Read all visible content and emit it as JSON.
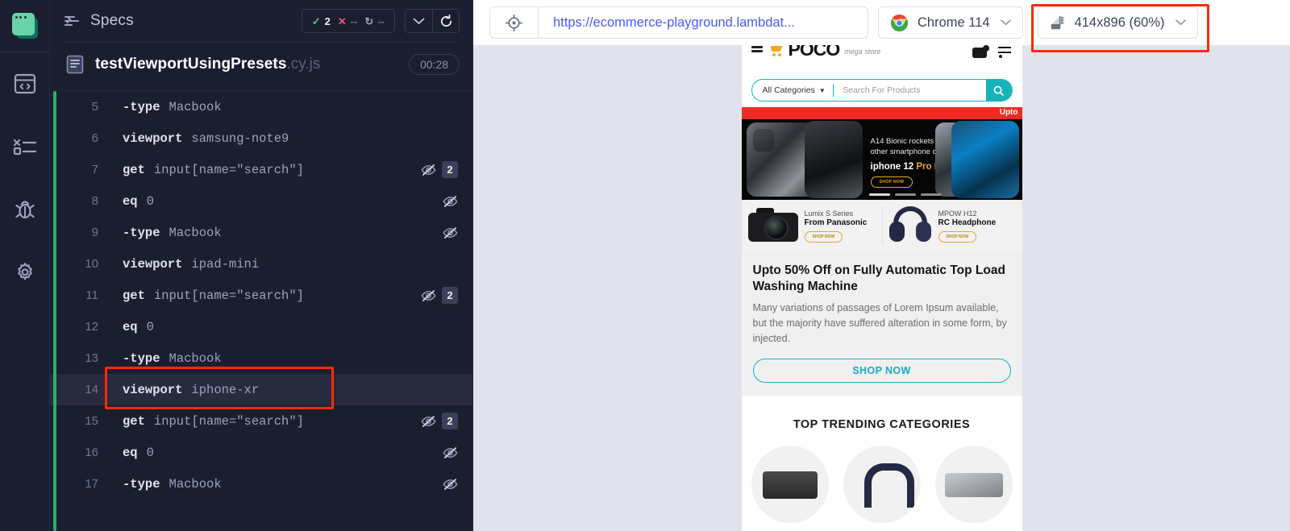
{
  "sidebar": {
    "items": [
      {
        "name": "cypress-logo",
        "label": "Cypress"
      },
      {
        "name": "specs",
        "label": "Specs"
      },
      {
        "name": "runs",
        "label": "Runs"
      },
      {
        "name": "debug",
        "label": "Debug"
      },
      {
        "name": "settings",
        "label": "Settings"
      }
    ]
  },
  "log_header": {
    "title": "Specs",
    "stats": {
      "passed_mark": "✓",
      "passed": "2",
      "failed_mark": "✕",
      "failed": "--",
      "pending_mark": "↻",
      "pending": "--"
    },
    "collapse_label": "Collapse",
    "reload_label": "Reload"
  },
  "spec": {
    "name": "testViewportUsingPresets",
    "extension": ".cy.js",
    "duration": "00:28"
  },
  "commands": [
    {
      "num": "5",
      "method": "-type",
      "arg": "Macbook",
      "hidden": false,
      "count": ""
    },
    {
      "num": "6",
      "method": "viewport",
      "arg": "samsung-note9",
      "hidden": false,
      "count": ""
    },
    {
      "num": "7",
      "method": "get",
      "arg": "input[name=\"search\"]",
      "hidden": true,
      "count": "2"
    },
    {
      "num": "8",
      "method": "eq",
      "arg": "0",
      "hidden": true,
      "count": ""
    },
    {
      "num": "9",
      "method": "-type",
      "arg": "Macbook",
      "hidden": true,
      "count": ""
    },
    {
      "num": "10",
      "method": "viewport",
      "arg": "ipad-mini",
      "hidden": false,
      "count": ""
    },
    {
      "num": "11",
      "method": "get",
      "arg": "input[name=\"search\"]",
      "hidden": true,
      "count": "2"
    },
    {
      "num": "12",
      "method": "eq",
      "arg": "0",
      "hidden": false,
      "count": ""
    },
    {
      "num": "13",
      "method": "-type",
      "arg": "Macbook",
      "hidden": false,
      "count": ""
    },
    {
      "num": "14",
      "method": "viewport",
      "arg": "iphone-xr",
      "hidden": false,
      "count": "",
      "selected": true,
      "highlighted": true
    },
    {
      "num": "15",
      "method": "get",
      "arg": "input[name=\"search\"]",
      "hidden": true,
      "count": "2"
    },
    {
      "num": "16",
      "method": "eq",
      "arg": "0",
      "hidden": true,
      "count": ""
    },
    {
      "num": "17",
      "method": "-type",
      "arg": "Macbook",
      "hidden": true,
      "count": ""
    }
  ],
  "topbar": {
    "selector_playground_label": "Open Selector Playground",
    "url": "https://ecommerce-playground.lambdat...",
    "browser": "Chrome 114",
    "viewport": "414x896 (60%)",
    "chevron": "⌄",
    "viewport_highlighted": true
  },
  "app": {
    "logo_text": "POCO",
    "logo_sub": "mega store",
    "category_select": "All Categories",
    "search_placeholder": "Search For Products",
    "red_strip_text": "Upto",
    "hero": {
      "line1": "A14 Bionic rockets past",
      "line2": "other smartphone chip.",
      "brand": "iphone 12 ",
      "brand_accent": "Pro Max",
      "cta": "SHOP NOW"
    },
    "promos": [
      {
        "top": "Lumix S Series",
        "bottom": "From Panasonic",
        "cta": "SHOP NOW"
      },
      {
        "top": "MPOW H12",
        "bottom": "RC Headphone",
        "cta": "SHOP NOW"
      }
    ],
    "feature": {
      "title": "Upto 50% Off on Fully Automatic Top Load Washing Machine",
      "body": "Many variations of passages of Lorem Ipsum available, but the majority have suffered alteration in some form, by injected.",
      "cta": "SHOP NOW"
    },
    "trending_title": "TOP TRENDING CATEGORIES"
  },
  "colors": {
    "accent_green": "#1fb46e",
    "fail_red": "#e8586a",
    "link_blue": "#4a5bf0",
    "highlight_red": "#fc2a0f",
    "store_teal": "#17b3bb",
    "banner_red": "#ee2c25"
  }
}
